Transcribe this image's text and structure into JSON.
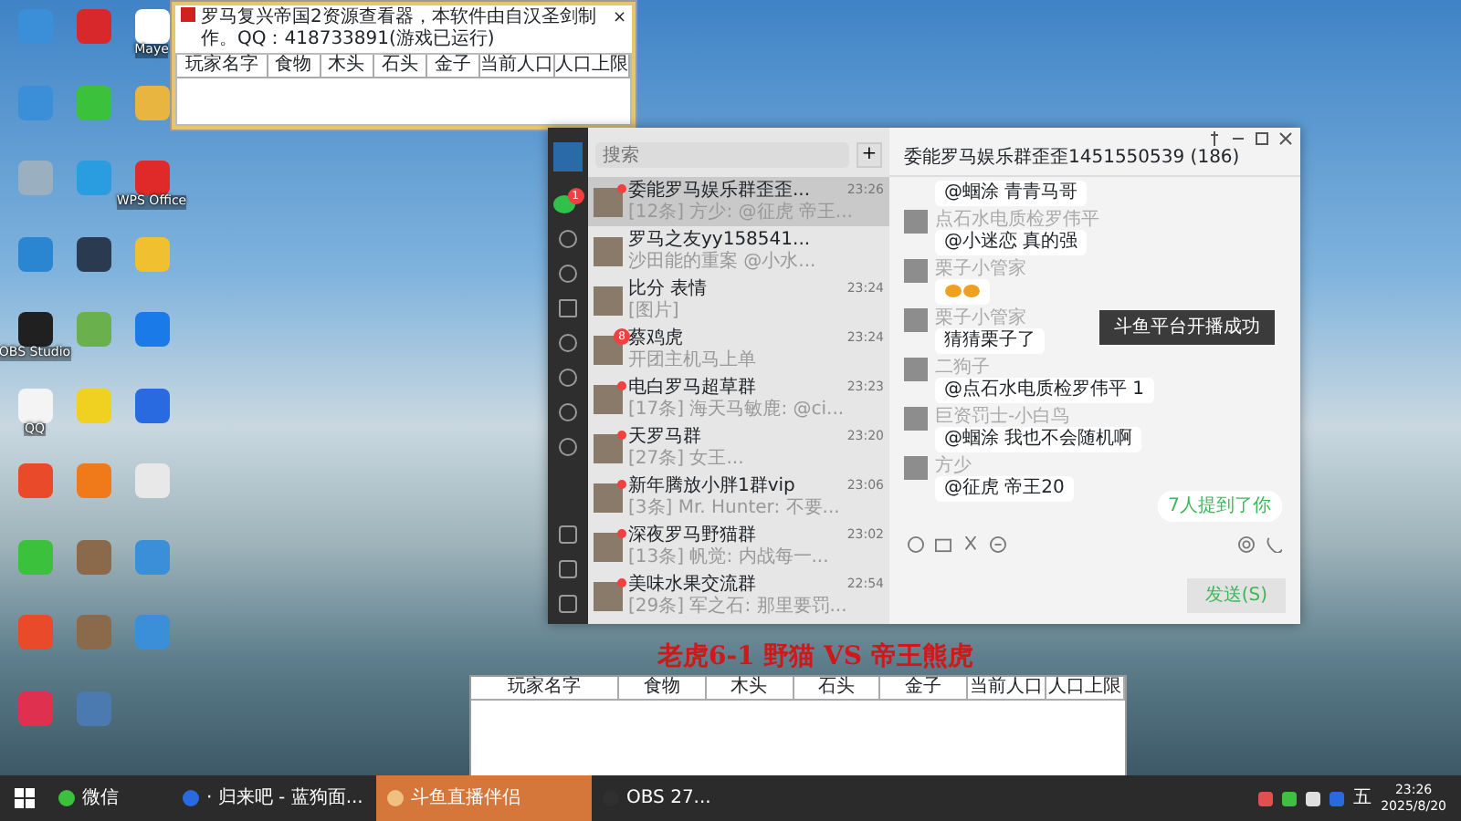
{
  "desktop_icons": [
    {
      "color": "#3a8fd8"
    },
    {
      "color": "#d9282c"
    },
    {
      "label": "Maye",
      "color": "#ffffff"
    },
    {
      "color": "#3a8fd8"
    },
    {
      "color": "#3cc13c"
    },
    {
      "color": "#e8b640"
    },
    {
      "color": "#9ab0c0"
    },
    {
      "color": "#2a9de0"
    },
    {
      "label": "WPS Office",
      "color": "#e02a2a"
    },
    {
      "color": "#2a86d0"
    },
    {
      "color": "#2a3a50"
    },
    {
      "color": "#f0c030"
    },
    {
      "label": "OBS Studio",
      "color": "#202020"
    },
    {
      "color": "#6ab04c"
    },
    {
      "color": "#1a7ae8"
    },
    {
      "label": "QQ",
      "color": "#f4f4f4"
    },
    {
      "color": "#f0d020"
    },
    {
      "color": "#2a6ae0"
    },
    {
      "color": "#e84a2a"
    },
    {
      "color": "#f07a1a"
    },
    {
      "color": "#e8e8e8"
    },
    {
      "color": "#3cc13c"
    },
    {
      "color": "#8a6a4a"
    },
    {
      "color": "#3a8fd8"
    },
    {
      "color": "#e84a2a"
    },
    {
      "color": "#8a6a4a"
    },
    {
      "color": "#3a8fd8"
    },
    {
      "color": "#e03050"
    },
    {
      "color": "#4a7ab0"
    }
  ],
  "viewer": {
    "title": "罗马复兴帝国2资源查看器，本软件由自汉圣剑制作。QQ：418733891(游戏已运行)",
    "close": "×",
    "columns": [
      "玩家名字",
      "食物",
      "木头",
      "石头",
      "金子",
      "当前人口",
      "人口上限"
    ]
  },
  "chat_app": {
    "search": {
      "placeholder": "搜索"
    },
    "add": "+",
    "sidebar_badge": "1",
    "conversations": [
      {
        "name": "委能罗马娱乐群歪歪...",
        "time": "23:26",
        "preview": "[12条] 方少: @征虎 帝王...",
        "unread": true,
        "selected": true
      },
      {
        "name": "罗马之友yy158541...",
        "preview": "沙田能的重案 @小水...",
        "unread": false,
        "selected": false
      },
      {
        "name": "比分  表情",
        "time": "23:24",
        "preview": "[图片]",
        "unread": false,
        "selected": false
      },
      {
        "name": "蔡鸡虎",
        "time": "23:24",
        "preview": "开团主机马上单",
        "unread": true,
        "badge": "8",
        "selected": false
      },
      {
        "name": "电白罗马超草群",
        "time": "23:23",
        "preview": "[17条] 海天马敏鹿: @ci...",
        "unread": true,
        "selected": false
      },
      {
        "name": "天罗马群",
        "time": "23:20",
        "preview": "[27条] 女王...",
        "unread": true,
        "selected": false
      },
      {
        "name": "新年腾放小胖1群vip",
        "time": "23:06",
        "preview": "[3条] Mr. Hunter: 不要...",
        "unread": true,
        "selected": false
      },
      {
        "name": "深夜罗马野猫群",
        "time": "23:02",
        "preview": "[13条] 帆觉: 内战每一...",
        "unread": true,
        "selected": false
      },
      {
        "name": "美味水果交流群",
        "time": "22:54",
        "preview": "[29条] 军之石: 那里要罚...",
        "unread": true,
        "selected": false
      }
    ],
    "title": "委能罗马娱乐群歪歪1451550539 (186)",
    "messages": [
      {
        "kind": "text",
        "text": "@蝈涂 青青马哥"
      },
      {
        "kind": "text",
        "sender": "点石水电质检罗伟平",
        "text": "@小迷恋 真的强"
      },
      {
        "kind": "sticker",
        "sender": "栗子小管家"
      },
      {
        "kind": "text",
        "sender": "栗子小管家",
        "text": "猜猜栗子了"
      },
      {
        "kind": "text",
        "sender": "二狗子",
        "text": "@点石水电质检罗伟平 1"
      },
      {
        "kind": "text",
        "sender": "巨资罚士-小白鸟",
        "text": "@蝈涂 我也不会随机啊"
      },
      {
        "kind": "text",
        "sender": "方少",
        "text": "@征虎 帝王20"
      }
    ],
    "toast": "斗鱼平台开播成功",
    "mention": "7人提到了你",
    "send": "发送(S)"
  },
  "overlay_text": "老虎6-1 野猫 VS 帝王熊虎",
  "score_table": {
    "columns": [
      "玩家名字",
      "食物",
      "木头",
      "石头",
      "金子",
      "当前人口",
      "人口上限"
    ]
  },
  "taskbar": {
    "items": [
      {
        "label": "微信",
        "active": false
      },
      {
        "label": "· 归来吧 - 蓝狗面...",
        "active": false
      },
      {
        "label": "斗鱼直播伴侣",
        "active": true
      },
      {
        "label": "OBS 27...",
        "active": false
      }
    ],
    "ime": "五",
    "time": "23:26",
    "date": "2025/8/20"
  }
}
